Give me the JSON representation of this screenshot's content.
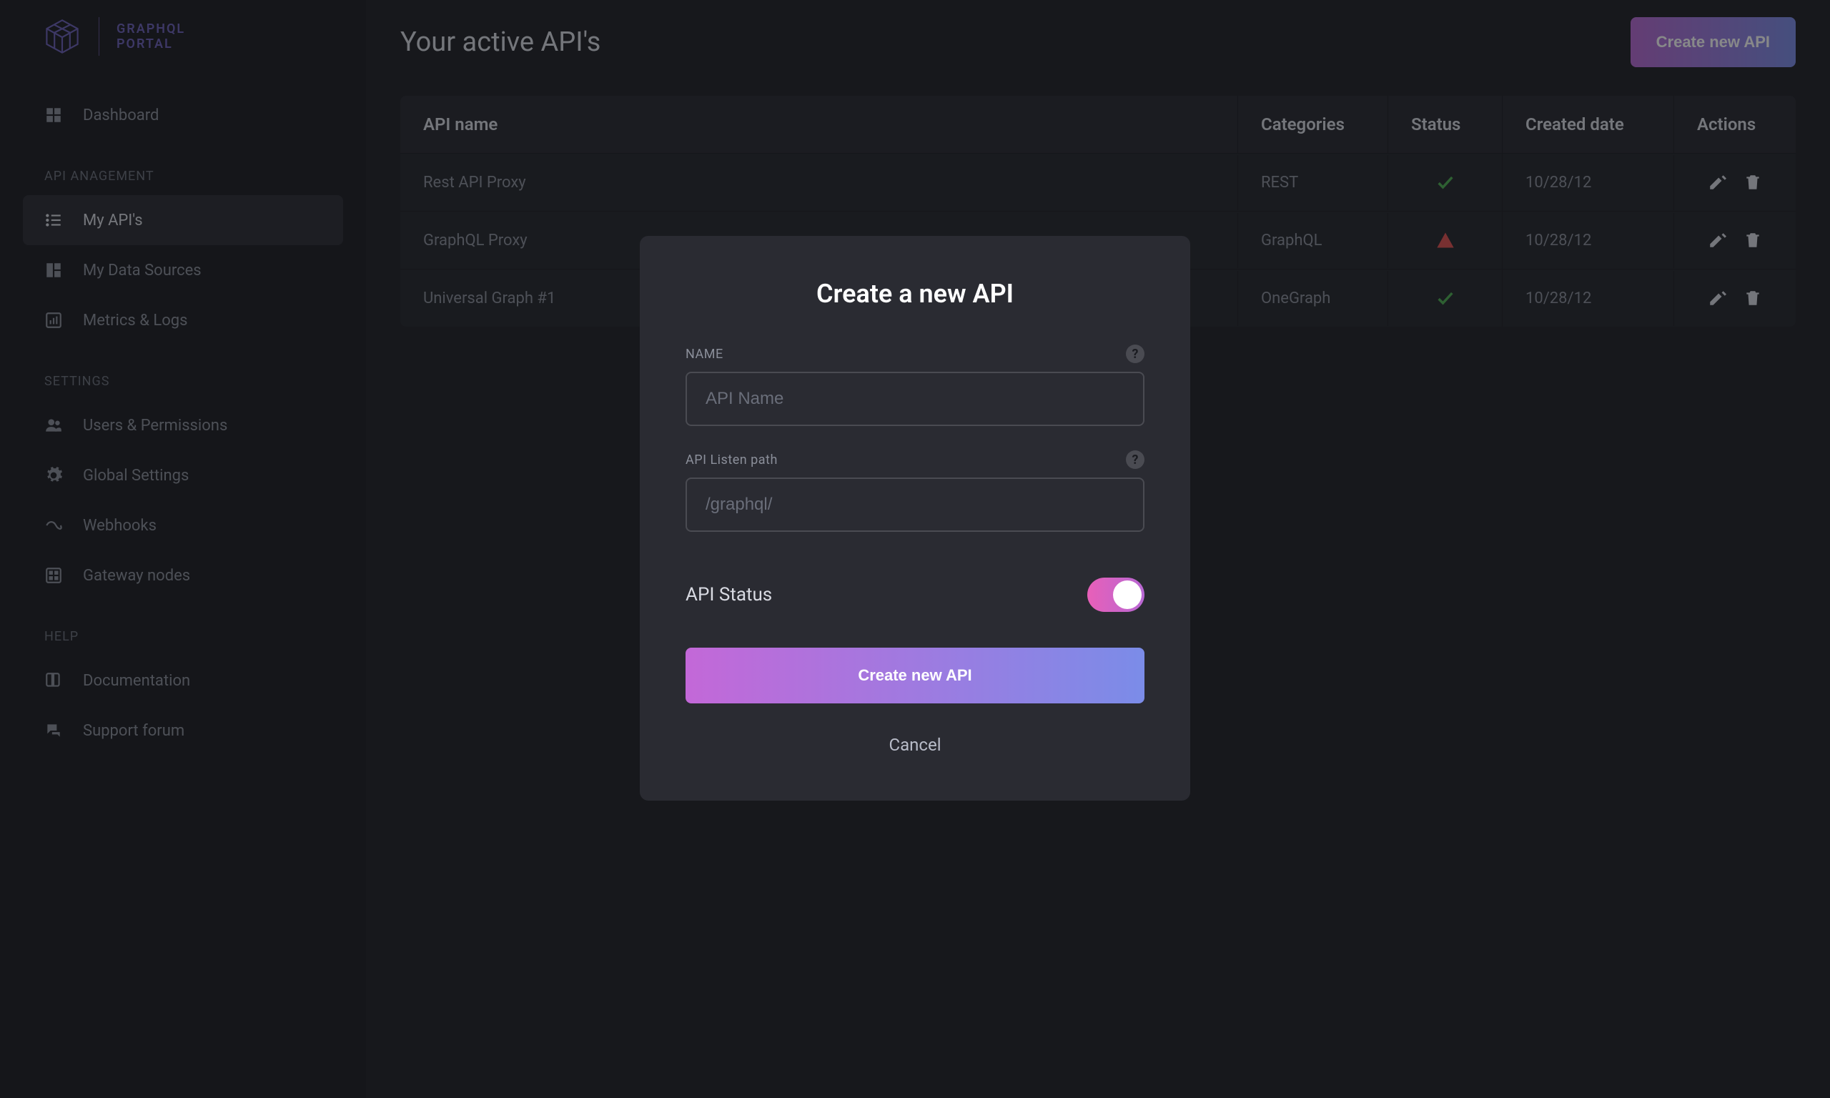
{
  "logo": {
    "line1": "GRAPHQL",
    "line2": "PORTAL"
  },
  "sidebar": {
    "dashboard": "Dashboard",
    "section_api": "API ANAGEMENT",
    "my_apis": "My API's",
    "data_sources": "My Data Sources",
    "metrics": "Metrics & Logs",
    "section_settings": "SETTINGS",
    "users": "Users & Permissions",
    "global": "Global Settings",
    "webhooks": "Webhooks",
    "gateway": "Gateway nodes",
    "section_help": "HELP",
    "docs": "Documentation",
    "forum": "Support forum"
  },
  "page": {
    "title": "Your active API's",
    "create_btn": "Create new API"
  },
  "table": {
    "headers": {
      "name": "API name",
      "categories": "Categories",
      "status": "Status",
      "created": "Created date",
      "actions": "Actions"
    },
    "rows": [
      {
        "name": "Rest API Proxy",
        "category": "REST",
        "status": "ok",
        "created": "10/28/12"
      },
      {
        "name": "GraphQL Proxy",
        "category": "GraphQL",
        "status": "warn",
        "created": "10/28/12"
      },
      {
        "name": "Universal Graph #1",
        "category": "OneGraph",
        "status": "ok",
        "created": "10/28/12"
      }
    ]
  },
  "modal": {
    "title": "Create a new API",
    "name_label": "NAME",
    "name_placeholder": "API Name",
    "path_label": "API Listen path",
    "path_placeholder": "/graphql/",
    "status_label": "API Status",
    "create_btn": "Create new API",
    "cancel": "Cancel"
  }
}
